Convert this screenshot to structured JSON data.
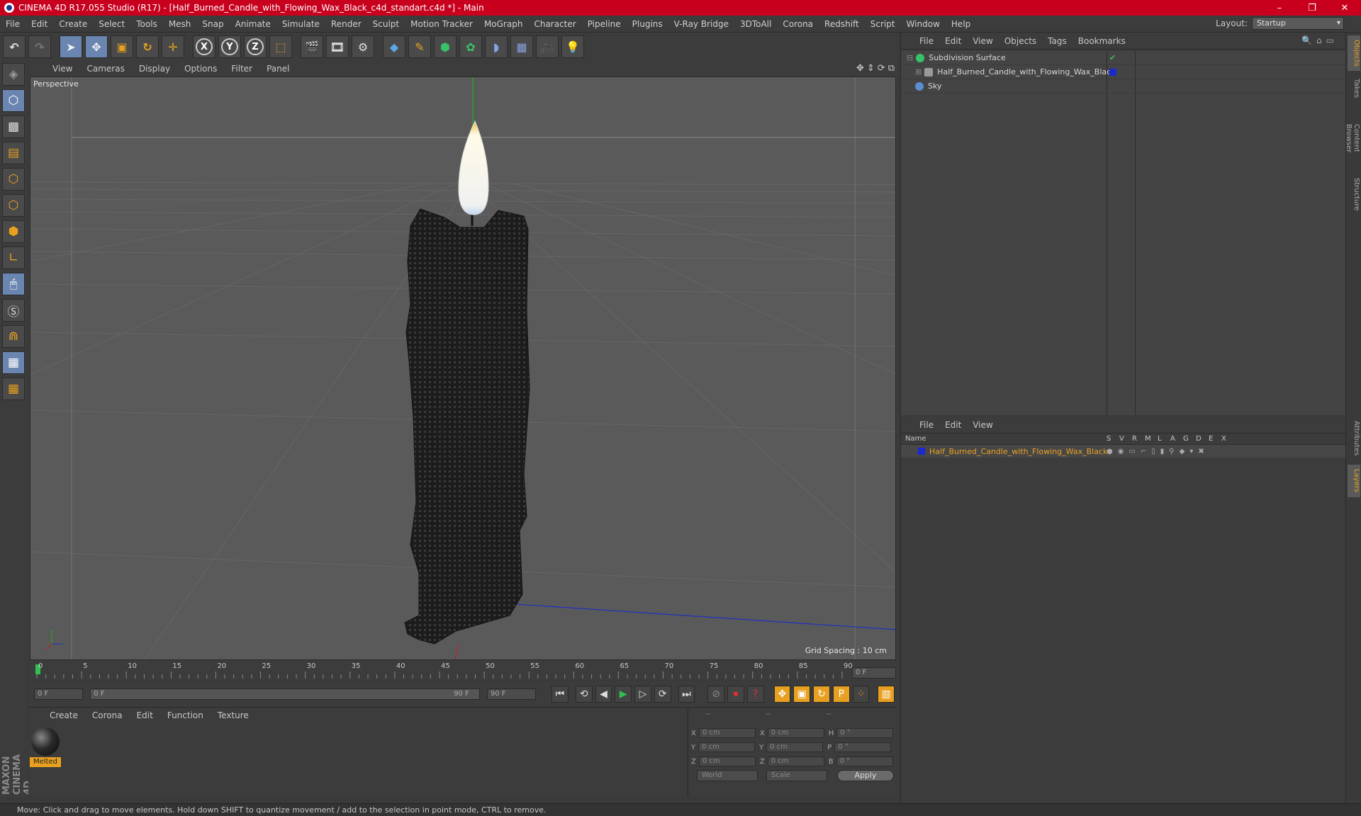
{
  "window": {
    "title": "CINEMA 4D R17.055 Studio (R17) - [Half_Burned_Candle_with_Flowing_Wax_Black_c4d_standart.c4d *] - Main",
    "minimize": "–",
    "maximize": "❐",
    "close": "✕"
  },
  "menu": [
    "File",
    "Edit",
    "Create",
    "Select",
    "Tools",
    "Mesh",
    "Snap",
    "Animate",
    "Simulate",
    "Render",
    "Sculpt",
    "Motion Tracker",
    "MoGraph",
    "Character",
    "Pipeline",
    "Plugins",
    "V-Ray Bridge",
    "3DToAll",
    "Corona",
    "Redshift",
    "Script",
    "Window",
    "Help"
  ],
  "layout": {
    "label": "Layout:",
    "value": "Startup"
  },
  "toolbar": {
    "axis_x": "X",
    "axis_y": "Y",
    "axis_z": "Z"
  },
  "viewport": {
    "menu": [
      "View",
      "Cameras",
      "Display",
      "Options",
      "Filter",
      "Panel"
    ],
    "camera_label": "Perspective",
    "grid_spacing": "Grid Spacing : 10 cm"
  },
  "timeline": {
    "ticks": [
      "0",
      "5",
      "10",
      "15",
      "20",
      "25",
      "30",
      "35",
      "40",
      "45",
      "50",
      "55",
      "60",
      "65",
      "70",
      "75",
      "80",
      "85",
      "90"
    ],
    "current_frame": "0 F",
    "start_frame": "0 F",
    "range_start": "0 F",
    "range_end": "90 F",
    "end_frame": "90 F"
  },
  "material_manager": {
    "menu": [
      "Create",
      "Corona",
      "Edit",
      "Function",
      "Texture"
    ],
    "materials": [
      {
        "name": "Melted"
      }
    ]
  },
  "coordinates": {
    "header": [
      "--",
      "--",
      "--"
    ],
    "rows": [
      {
        "a": "X",
        "av": "0 cm",
        "b": "X",
        "bv": "0 cm",
        "c": "H",
        "cv": "0 °"
      },
      {
        "a": "Y",
        "av": "0 cm",
        "b": "Y",
        "bv": "0 cm",
        "c": "P",
        "cv": "0 °"
      },
      {
        "a": "Z",
        "av": "0 cm",
        "b": "Z",
        "bv": "0 cm",
        "c": "B",
        "cv": "0 °"
      }
    ],
    "space": "World",
    "mode": "Scale",
    "apply": "Apply"
  },
  "object_manager": {
    "menu": [
      "File",
      "Edit",
      "View",
      "Objects",
      "Tags",
      "Bookmarks"
    ],
    "objects": [
      {
        "name": "Subdivision Surface",
        "icon_color": "#37c26a"
      },
      {
        "name": "Half_Burned_Candle_with_Flowing_Wax_Black",
        "icon_color": "#9a9a9a"
      },
      {
        "name": "Sky",
        "icon_color": "#5a8fd0"
      }
    ]
  },
  "layer_manager": {
    "menu": [
      "File",
      "Edit",
      "View"
    ],
    "columns": [
      "Name",
      "S",
      "V",
      "R",
      "M",
      "L",
      "A",
      "G",
      "D",
      "E",
      "X"
    ],
    "layers": [
      {
        "name": "Half_Burned_Candle_with_Flowing_Wax_Black",
        "color": "#1a2ad0"
      }
    ]
  },
  "right_tabs": [
    "Objects",
    "Takes",
    "Content Browser",
    "Structure",
    "Attributes",
    "Layers"
  ],
  "status": "Move: Click and drag to move elements. Hold down SHIFT to quantize movement / add to the selection in point mode, CTRL to remove.",
  "brand": "MAXON CINEMA 4D"
}
